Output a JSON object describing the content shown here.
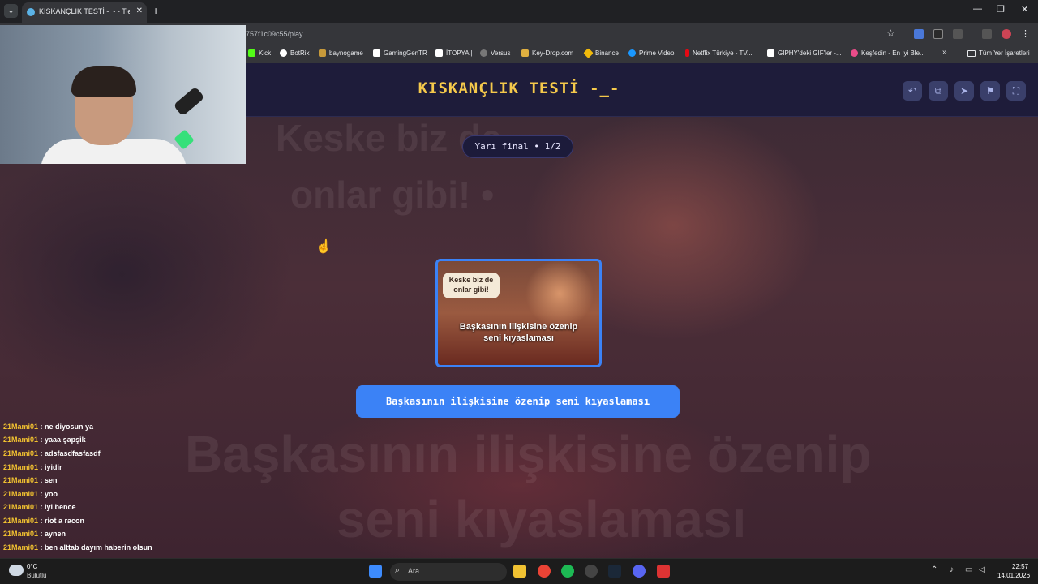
{
  "browser": {
    "tab_title": "KISKANÇLIK TESTİ -_- - Tier Lis",
    "url": "757f1c09c55/play",
    "new_tab": "+",
    "close": "✕",
    "bookmarks": [
      {
        "label": "Kick",
        "color": "#53fc18"
      },
      {
        "label": "BotRix",
        "color": "#ffffff"
      },
      {
        "label": "baynogame",
        "color": "#c79a3a"
      },
      {
        "label": "GamingGenTR",
        "color": "#ffffff"
      },
      {
        "label": "İTOPYA |",
        "color": "#ffffff"
      },
      {
        "label": "Versus",
        "color": "#777777"
      },
      {
        "label": "Key-Drop.com",
        "color": "#e0b040"
      },
      {
        "label": "Binance",
        "color": "#f0b90b"
      },
      {
        "label": "Prime Video",
        "color": "#1a98ff"
      },
      {
        "label": "Netflix Türkiye - TV...",
        "color": "#e50914"
      },
      {
        "label": "GIPHY'deki GIF'ler -...",
        "color": "#ffffff"
      },
      {
        "label": "Keşfedin - En İyi Ble...",
        "color": "#ea4c89"
      }
    ],
    "bookmarks_more": "»",
    "all_bookmarks": "Tüm Yer İşaretleri"
  },
  "game": {
    "title": "KISKANÇLIK TESTİ -_-",
    "round": "Yarı final • 1/2",
    "card_bubble": "Keske biz de onlar gibi!",
    "card_caption_line1": "Başkasının ilişkisine özenip",
    "card_caption_line2": "seni kıyaslaması",
    "choice_label": "Başkasının ilişkisine özenip seni kıyaslaması",
    "bg_text_1": "Keske biz de",
    "bg_text_2": "onlar gibi! •",
    "bg_text_3": "Başkasının ilişkisine özenip",
    "bg_text_4": "seni kıyaslaması"
  },
  "chat": [
    {
      "user": "21Mami01",
      "msg": ": ne diyosun ya"
    },
    {
      "user": "21Mami01",
      "msg": ": yaaa şapşik"
    },
    {
      "user": "21Mami01",
      "msg": ": adsfasdfasfasdf"
    },
    {
      "user": "21Mami01",
      "msg": ": iyidir"
    },
    {
      "user": "21Mami01",
      "msg": ": sen"
    },
    {
      "user": "21Mami01",
      "msg": ": yoo"
    },
    {
      "user": "21Mami01",
      "msg": ": iyi bence"
    },
    {
      "user": "21Mami01",
      "msg": ": riot a racon"
    },
    {
      "user": "21Mami01",
      "msg": ": aynen"
    },
    {
      "user": "21Mami01",
      "msg": ": ben alttab dayım haberin olsun"
    }
  ],
  "taskbar": {
    "temperature": "0°C",
    "condition": "Bulutlu",
    "search_placeholder": "Ara",
    "time": "22:57",
    "date": "14.01.2026"
  }
}
